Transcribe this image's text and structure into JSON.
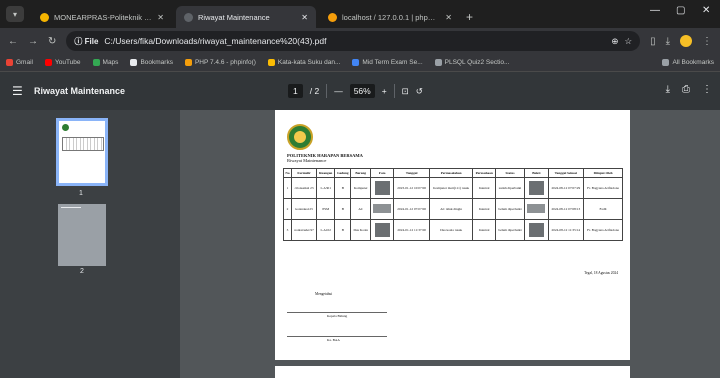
{
  "tabs": [
    {
      "title": "MONEARPRAS-Politeknik Harai",
      "favicon_color": "#f5b400",
      "active": false
    },
    {
      "title": "Riwayat Maintenance",
      "favicon_color": "#5f6368",
      "active": true
    },
    {
      "title": "localhost / 127.0.0.1 | phpMyA",
      "favicon_color": "#f59e0b",
      "active": false
    }
  ],
  "tab_menu_icon": "chevron-down-icon",
  "toolbar": {
    "back_icon": "←",
    "forward_icon": "→",
    "reload_icon": "↻",
    "chip": "ⓘ File",
    "url": "C:/Users/fika/Downloads/riwayat_maintenance%20(43).pdf"
  },
  "bookmarks": [
    {
      "label": "Gmail",
      "color": "#ea4335"
    },
    {
      "label": "YouTube",
      "color": "#ff0000"
    },
    {
      "label": "Maps",
      "color": "#34a853"
    },
    {
      "label": "Bookmarks",
      "color": "#e8eaed"
    },
    {
      "label": "PHP 7.4.6 - phpinfo()",
      "color": "#f59e0b"
    },
    {
      "label": "Kata-kata Suku dan...",
      "color": "#fbbc04"
    },
    {
      "label": "Mid Term Exam Se...",
      "color": "#4285f4"
    },
    {
      "label": "PLSQL Quiz2 Sectio...",
      "color": "#9aa0a6"
    }
  ],
  "all_bookmarks": "All Bookmarks",
  "pdf": {
    "title": "Riwayat Maintenance",
    "page_current": "1",
    "page_total": "/ 2",
    "zoom": "56%"
  },
  "thumbnails": [
    "1",
    "2"
  ],
  "document": {
    "institution": "POLITEKNIK HARAPAN BERSAMA",
    "subtitle": "Riwayat Maintenance",
    "headers": [
      "No",
      "Formulir",
      "Ruangan",
      "Gedung",
      "Barang",
      "Foto",
      "Tanggal",
      "Permasalahan",
      "Perusahaan",
      "Status",
      "Bukti",
      "Tanggal Selesai",
      "Diinput Oleh"
    ],
    "rows": [
      [
        "1",
        "cilonsetkal 23",
        "L.A301",
        "B",
        "Komputer",
        "",
        "2023-01-12 10:07:00",
        "Komputer mati(111) rusak",
        "Internal",
        "sudah diperbaiki",
        "",
        "2024-08-12 07:07:29",
        "Fr. Bagyana Arifiadona"
      ],
      [
        "2",
        "kotanaka123",
        "PSM",
        "B",
        "AC",
        "",
        "2024-01-12 07:07:00",
        "AC tidak dingin",
        "Internal",
        "belum diperbaiki",
        "",
        "2024-08-12 07:08:13",
        "Fadli"
      ],
      [
        "3",
        "nonistrudet 97",
        "L.A102",
        "B",
        "Dus Koala",
        "",
        "2024-01-12 11:37:00",
        "Dus koala rusak",
        "Internal",
        "belum diperbaiki",
        "",
        "2024-08-12 11:35:14",
        "Fr. Bagyana Arifiadona"
      ]
    ],
    "place_date": "Tegal, 18 Agustus 2024",
    "mengetahui": "Mengetahui",
    "signer1": "Kepala Bidang",
    "signer2": "Ka. BAA"
  }
}
